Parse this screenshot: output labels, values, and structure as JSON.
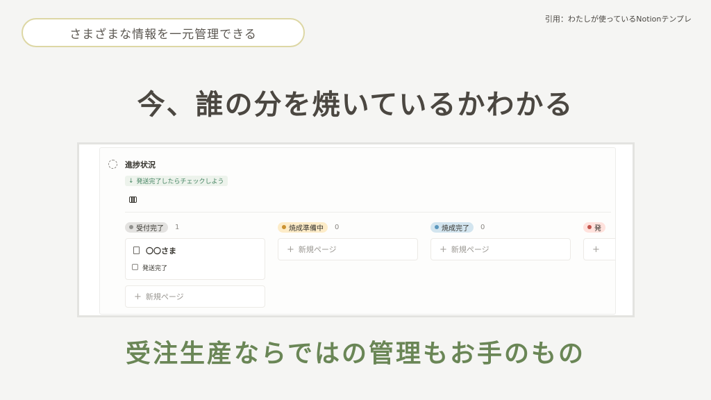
{
  "badge": {
    "text": "さまざまな情報を一元管理できる"
  },
  "citation": "引用：わたしが使っているNotionテンプレ",
  "headline": "今、誰の分を焼いているかわかる",
  "subline": "受注生産ならではの管理もお手のもの",
  "board": {
    "title": "進捗状況",
    "callout_arrow": "↓",
    "callout": "発送完了したらチェックしよう",
    "view_icon": "board-view-icon",
    "columns": [
      {
        "status": "受付完了",
        "count": "1",
        "tag_bg": "#e3e2e0",
        "dot_color": "#91918e",
        "card": {
          "title": "〇〇さま",
          "checkbox_label": "発送完了",
          "checked": false
        },
        "new_page": "新規ページ"
      },
      {
        "status": "焼成準備中",
        "count": "0",
        "tag_bg": "#fdecc8",
        "dot_color": "#cb912f",
        "new_page": "新規ページ"
      },
      {
        "status": "焼成完了",
        "count": "0",
        "tag_bg": "#d3e5ef",
        "dot_color": "#5b97bd",
        "new_page": "新規ページ"
      },
      {
        "status": "発",
        "count": "",
        "tag_bg": "#ffe2dd",
        "dot_color": "#c4554d",
        "new_page": ""
      }
    ]
  },
  "colors": {
    "background": "#f5f5f3",
    "badge_border": "#ddd7a4",
    "headline": "#4b4741",
    "subline": "#6a8656",
    "callout_bg": "#edf3ec",
    "callout_text": "#448361"
  }
}
